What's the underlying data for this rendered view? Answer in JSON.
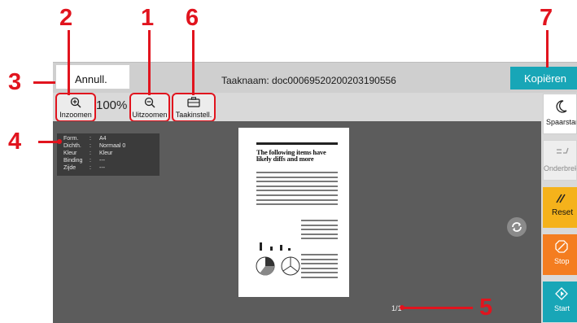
{
  "callouts": [
    "1",
    "2",
    "3",
    "4",
    "5",
    "6",
    "7"
  ],
  "header": {
    "cancel_label": "Annull.",
    "job_name": "Taaknaam: doc00069520200203190556",
    "copy_label": "Kopiëren"
  },
  "toolbar": {
    "zoom_in_label": "Inzoomen",
    "zoom_level": "100%",
    "zoom_out_label": "Uitzoomen",
    "job_settings_label": "Taakinstell."
  },
  "info": {
    "rows": [
      {
        "key": "Form.",
        "value": "A4"
      },
      {
        "key": "Dichth.",
        "value": "Normaal 0"
      },
      {
        "key": "Kleur",
        "value": "Kleur"
      },
      {
        "key": "Binding",
        "value": "---"
      },
      {
        "key": "Zijde",
        "value": "---"
      }
    ],
    "separator": ":"
  },
  "preview": {
    "heading": "The following items have likely diffs and more",
    "page_indicator": "1/1"
  },
  "side": {
    "sleep_label": "Spaarstand",
    "interrupt_label": "Onderbreken",
    "reset_label": "Reset",
    "stop_label": "Stop",
    "start_label": "Start"
  },
  "colors": {
    "accent": "#18a6b7",
    "callout": "#e1141e",
    "reset": "#f5b21b",
    "stop": "#f47d20",
    "start": "#18a6b7"
  },
  "icons": [
    "zoom-in-icon",
    "zoom-out-icon",
    "toolbox-icon",
    "moon-icon",
    "interrupt-icon",
    "reset-icon",
    "stop-icon",
    "start-icon",
    "rotate-icon"
  ]
}
